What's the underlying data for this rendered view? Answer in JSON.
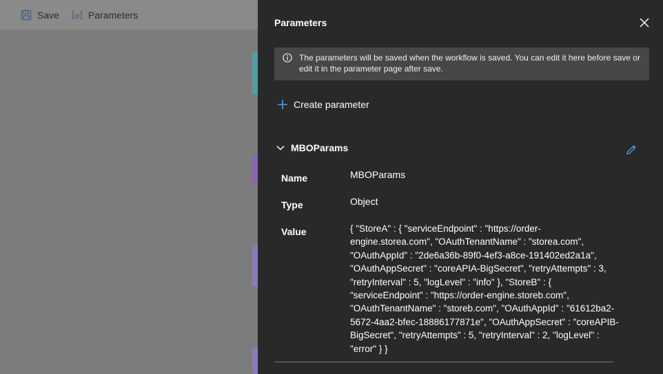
{
  "toolbar": {
    "save_label": "Save",
    "save_icon": "save-icon",
    "parameters_label": "Parameters",
    "parameters_icon": "parameters-icon"
  },
  "panel": {
    "title": "Parameters",
    "info_text": "The parameters will be saved when the workflow is saved. You can edit it here before save or edit it in the parameter page after save.",
    "create_label": "Create parameter",
    "parameter": {
      "header": "MBOParams",
      "name_label": "Name",
      "name_value": "MBOParams",
      "type_label": "Type",
      "type_value": "Object",
      "value_label": "Value",
      "value_text": "{ \"StoreA\" : { \"serviceEndpoint\" : \"https://order-engine.storea.com\", \"OAuthTenantName\" : \"storea.com\", \"OAuthAppId\" : \"2de6a36b-89f0-4ef3-a8ce-191402ed2a1a\", \"OAuthAppSecret\" : \"coreAPIA-BigSecret\", \"retryAttempts\" : 3, \"retryInterval\" : 5, \"logLevel\" : \"info\" }, \"StoreB\" : { \"serviceEndpoint\" : \"https://order-engine.storeb.com\", \"OAuthTenantName\" : \"storeb.com\", \"OAuthAppId\" : \"61612ba2-5672-4aa2-bfec-18886177871e\", \"OAuthAppSecret\" : \"coreAPIB-BigSecret\", \"retryAttempts\" : 5, \"retryInterval\" : 2, \"logLevel\" : \"error\" } }"
    }
  },
  "colors": {
    "panel_bg": "#292929",
    "info_bg": "#474747",
    "accent": "#4f9fe8"
  }
}
